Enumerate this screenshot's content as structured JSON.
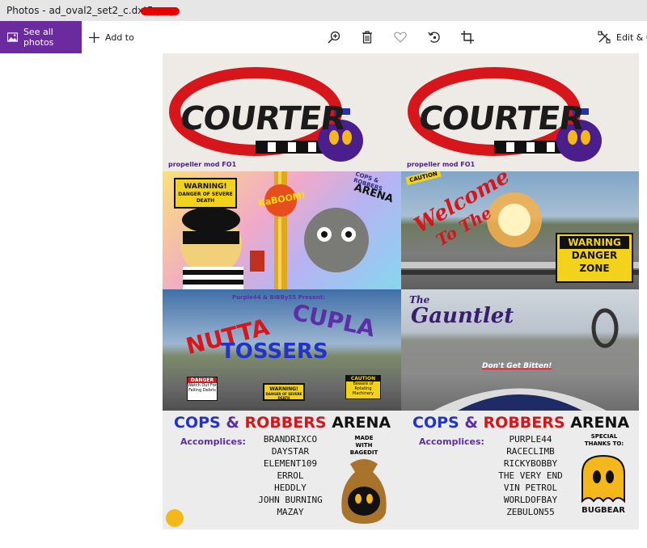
{
  "window": {
    "title": "Photos - ad_oval2_set2_c.dxt5.png"
  },
  "toolbar": {
    "see_all_photos": "See all photos",
    "add_to": "Add to",
    "edit_create": "Edit & C"
  },
  "colors": {
    "accent": "#6b2b9e",
    "redaction": "#e60000"
  },
  "icons": [
    "photos-icon",
    "plus-icon",
    "zoom-in-icon",
    "delete-icon",
    "heart-icon",
    "rotate-icon",
    "crop-icon",
    "edit-create-icon"
  ],
  "image": {
    "tiles": {
      "courter_left": {
        "logo": "COURTER",
        "caption": "propeller mod FO1"
      },
      "courter_right": {
        "logo": "COURTER",
        "caption": "propeller mod FO1"
      },
      "cops_arena": {
        "warning": "WARNING!",
        "warning_sub": "DANGER OF SEVERE DEATH",
        "kaboom": "KaBOOM!",
        "cops_tag": "COPS & ROBBERS",
        "arena_tag": "ARENA"
      },
      "welcome": {
        "caution": "CAUTION",
        "headline_1": "Welcome",
        "headline_2": "To The",
        "warning": "WARNING",
        "danger": "DANGER",
        "zone": "ZONE"
      },
      "nutta": {
        "presenters": "Purple44 & BiBBy55 Present:",
        "word_1": "NUTTA",
        "word_2": "CUPLA",
        "word_3": "TOSSERS",
        "danger": "DANGER",
        "danger_sub": "Watch Out For Falling Debris",
        "warning": "WARNING!",
        "warning_sub": "DANGER OF SEVERE DEATH",
        "caution": "CAUTION",
        "caution_sub": "Beware of Rotating Machinery"
      },
      "gauntlet": {
        "the": "The",
        "title": "Gauntlet",
        "tagline": "Don't Get Bitten!"
      },
      "credits_left": {
        "title_a": "COPS",
        "title_amp": "&",
        "title_b": "ROBBERS",
        "title_c": "ARENA",
        "label": "Accomplices:",
        "names": [
          "BRANDRIXCO",
          "DAYSTAR",
          "ELEMENT109",
          "ERROL",
          "HEDDLY",
          "JOHN BURNING",
          "MAZAY"
        ],
        "made_with": "MADE WITH BAGEDIT"
      },
      "credits_right": {
        "title_a": "COPS",
        "title_amp": "&",
        "title_b": "ROBBERS",
        "title_c": "ARENA",
        "label": "Accomplices:",
        "names": [
          "PURPLE44",
          "RACECLIMB",
          "RICKYBOBBY",
          "THE VERY END",
          "VIN PETROL",
          "WORLDOFBAY",
          "ZEBULON55"
        ],
        "thanks": "SPECIAL THANKS TO:",
        "sponsor": "BUGBEAR"
      }
    }
  }
}
